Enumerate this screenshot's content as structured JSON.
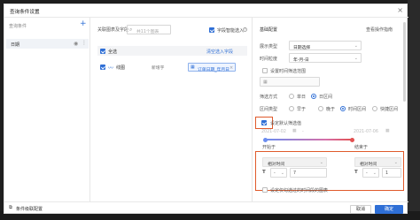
{
  "dialog": {
    "title": "查询条件设置",
    "close_glyph": "×"
  },
  "left": {
    "section_label": "查询条件",
    "add_glyph": "+",
    "items": [
      {
        "label": "日期"
      }
    ]
  },
  "mid": {
    "related_label": "关联图表及字段",
    "search_placeholder": "共11个图表",
    "smart_checkbox_label": "字段智能选入",
    "select_all_label": "全选",
    "clear_selected_link": "清空选入字段",
    "rows": [
      {
        "chart_name": "线图",
        "dataset": "新增字",
        "field": "订单日期_年月日"
      }
    ]
  },
  "right": {
    "basic_config": "基础配置",
    "help_link": "查看操作指南",
    "display_type_label": "展示类型",
    "display_type_value": "日期选择",
    "time_granularity_label": "时间粒度",
    "time_granularity_value": "年-月-日",
    "query_range_label": "设置时间筛选范围",
    "filter_mode_label": "筛选方式",
    "filter_modes": [
      {
        "label": "单日",
        "selected": false
      },
      {
        "label": "日区间",
        "selected": true
      }
    ],
    "interval_type_label": "区间类型",
    "interval_types": [
      {
        "label": "早于",
        "selected": false
      },
      {
        "label": "晚于",
        "selected": false
      },
      {
        "label": "时间区间",
        "selected": true
      },
      {
        "label": "快捷区间",
        "selected": false
      }
    ],
    "default_value_label": "设定默认筛选值",
    "default_value_checked": true,
    "date_start": "2021-07-02",
    "date_end": "2021-07-06",
    "start_label": "开始于",
    "end_label": "结束于",
    "relative_time_label": "相对时间",
    "t_glyph": "T",
    "minus_glyph": "-",
    "start_value": "7",
    "end_value": "1",
    "only_link_label": "设定仅勾选过的时间段的图表"
  },
  "footer": {
    "left_button": "条件级联配置",
    "cancel": "取消",
    "ok": "确定"
  },
  "colors": {
    "accent": "#2f6fd6",
    "highlight": "#e05a2b"
  }
}
